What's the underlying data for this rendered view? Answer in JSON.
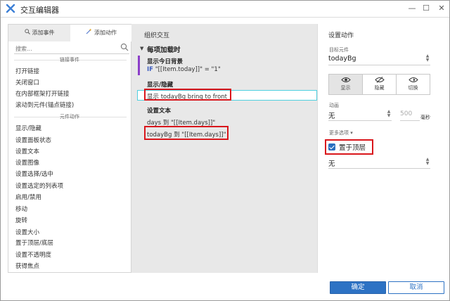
{
  "window": {
    "title": "交互编辑器",
    "min_glyph": "—",
    "max_glyph": "☐",
    "close_glyph": "✕"
  },
  "left_panel": {
    "tabs": [
      {
        "label": "添加事件",
        "icon": "magnifier-icon"
      },
      {
        "label": "添加动作",
        "icon": "magic-wand-icon"
      }
    ],
    "search_placeholder": "搜索...",
    "link_section": {
      "header": "链接事件",
      "items": [
        "打开链接",
        "关闭窗口",
        "在内部框架打开链接",
        "滚动到元件(锚点链接)"
      ]
    },
    "widget_section": {
      "header": "元件动作",
      "items": [
        "显示/隐藏",
        "设置面板状态",
        "设置文本",
        "设置图像",
        "设置选择/选中",
        "设置选定的列表项",
        "启用/禁用",
        "移动",
        "旋转",
        "设置大小",
        "置于顶层/底层",
        "设置不透明度",
        "获得焦点"
      ]
    }
  },
  "middle_panel": {
    "title": "组织交互",
    "event_title": "每项加载时",
    "case": {
      "title": "显示今日背景",
      "cond_keyword": "IF",
      "cond_text": "\"[[Item.today]]\" = \"1\""
    },
    "actions": [
      {
        "header": "显示/隐藏",
        "line": "显示 todayBg  bring to front"
      },
      {
        "header": "设置文本",
        "line1": "days 到 \"[[Item.days]]\"",
        "line2": "todayBg 到 \"[[Item.days]]\""
      }
    ]
  },
  "right_panel": {
    "title": "设置动作",
    "target_label": "目标元件",
    "target_value": "todayBg",
    "visibility": [
      {
        "label": "显示",
        "icon": "eye-icon",
        "active": true
      },
      {
        "label": "隐藏",
        "icon": "eye-off-icon",
        "active": false
      },
      {
        "label": "切换",
        "icon": "eye-toggle-icon",
        "active": false
      }
    ],
    "animation_label": "动画",
    "animation_value": "无",
    "duration_value": "500",
    "duration_unit": "毫秒",
    "more_options_label": "更多选项 ▾",
    "bring_front_label": "置于顶层",
    "bring_front_checked": true,
    "order_value": "无"
  },
  "footer": {
    "ok_label": "确定",
    "cancel_label": "取消"
  },
  "colors": {
    "primary": "#2d72c4",
    "highlight_red": "#d9161c",
    "case_bar": "#8c3fc9",
    "selected_row_border": "#4fd0e0"
  }
}
